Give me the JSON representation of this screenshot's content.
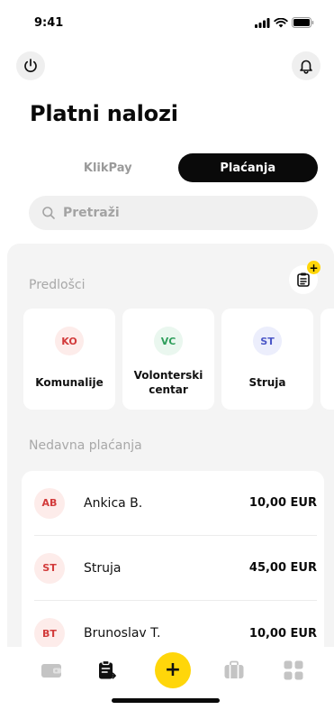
{
  "status_bar": {
    "time": "9:41",
    "icons": [
      "cellular-icon",
      "wifi-icon",
      "battery-icon"
    ]
  },
  "header": {
    "power_icon": "power-icon",
    "bell_icon": "bell-icon",
    "title": "Platni nalozi"
  },
  "tabs": [
    {
      "label": "KlikPay",
      "active": false
    },
    {
      "label": "Plaćanja",
      "active": true
    }
  ],
  "search": {
    "placeholder": "Pretraži",
    "icon": "search-icon"
  },
  "templates": {
    "label": "Predlošci",
    "add_icon": "clipboard-add-icon",
    "badge": "+",
    "items": [
      {
        "initials": "KO",
        "label": "Komunalije",
        "bg": "#fdecea",
        "fg": "#d23b3b"
      },
      {
        "initials": "VC",
        "label": "Volonterski centar",
        "bg": "#eaf7ef",
        "fg": "#2e9e5b"
      },
      {
        "initials": "ST",
        "label": "Struja",
        "bg": "#eceefc",
        "fg": "#4b57c7"
      }
    ]
  },
  "recent": {
    "label": "Nedavna plaćanja",
    "items": [
      {
        "initials": "AB",
        "name": "Ankica B.",
        "amount": "10,00 EUR"
      },
      {
        "initials": "ST",
        "name": "Struja",
        "amount": "45,00 EUR"
      },
      {
        "initials": "BT",
        "name": "Brunoslav T.",
        "amount": "10,00 EUR"
      }
    ]
  },
  "tab_bar": {
    "items": [
      {
        "icon": "wallet-icon",
        "active": false
      },
      {
        "icon": "payment-orders-icon",
        "active": true
      },
      {
        "icon": "add-icon",
        "symbol": "+",
        "active": false
      },
      {
        "icon": "briefcase-icon",
        "active": false
      },
      {
        "icon": "grid-icon",
        "active": false
      }
    ]
  },
  "colors": {
    "accent": "#ffd60a",
    "dark": "#0a0a0a",
    "muted": "#a8a8a8",
    "surface": "#f4f4f4"
  }
}
